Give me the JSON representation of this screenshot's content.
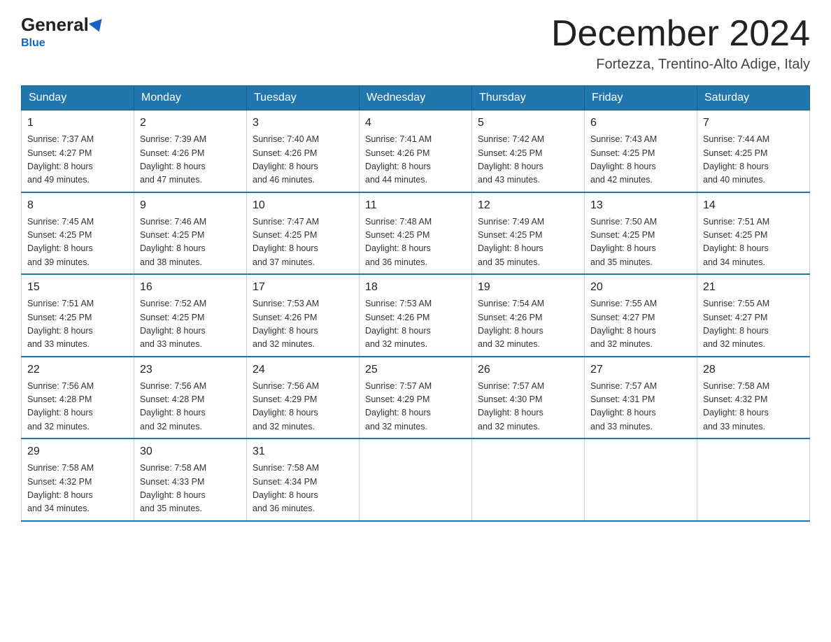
{
  "header": {
    "logo": {
      "general": "General",
      "blue": "Blue"
    },
    "title": "December 2024",
    "subtitle": "Fortezza, Trentino-Alto Adige, Italy"
  },
  "weekdays": [
    "Sunday",
    "Monday",
    "Tuesday",
    "Wednesday",
    "Thursday",
    "Friday",
    "Saturday"
  ],
  "weeks": [
    [
      {
        "day": "1",
        "sunrise": "7:37 AM",
        "sunset": "4:27 PM",
        "daylight": "8 hours and 49 minutes."
      },
      {
        "day": "2",
        "sunrise": "7:39 AM",
        "sunset": "4:26 PM",
        "daylight": "8 hours and 47 minutes."
      },
      {
        "day": "3",
        "sunrise": "7:40 AM",
        "sunset": "4:26 PM",
        "daylight": "8 hours and 46 minutes."
      },
      {
        "day": "4",
        "sunrise": "7:41 AM",
        "sunset": "4:26 PM",
        "daylight": "8 hours and 44 minutes."
      },
      {
        "day": "5",
        "sunrise": "7:42 AM",
        "sunset": "4:25 PM",
        "daylight": "8 hours and 43 minutes."
      },
      {
        "day": "6",
        "sunrise": "7:43 AM",
        "sunset": "4:25 PM",
        "daylight": "8 hours and 42 minutes."
      },
      {
        "day": "7",
        "sunrise": "7:44 AM",
        "sunset": "4:25 PM",
        "daylight": "8 hours and 40 minutes."
      }
    ],
    [
      {
        "day": "8",
        "sunrise": "7:45 AM",
        "sunset": "4:25 PM",
        "daylight": "8 hours and 39 minutes."
      },
      {
        "day": "9",
        "sunrise": "7:46 AM",
        "sunset": "4:25 PM",
        "daylight": "8 hours and 38 minutes."
      },
      {
        "day": "10",
        "sunrise": "7:47 AM",
        "sunset": "4:25 PM",
        "daylight": "8 hours and 37 minutes."
      },
      {
        "day": "11",
        "sunrise": "7:48 AM",
        "sunset": "4:25 PM",
        "daylight": "8 hours and 36 minutes."
      },
      {
        "day": "12",
        "sunrise": "7:49 AM",
        "sunset": "4:25 PM",
        "daylight": "8 hours and 35 minutes."
      },
      {
        "day": "13",
        "sunrise": "7:50 AM",
        "sunset": "4:25 PM",
        "daylight": "8 hours and 35 minutes."
      },
      {
        "day": "14",
        "sunrise": "7:51 AM",
        "sunset": "4:25 PM",
        "daylight": "8 hours and 34 minutes."
      }
    ],
    [
      {
        "day": "15",
        "sunrise": "7:51 AM",
        "sunset": "4:25 PM",
        "daylight": "8 hours and 33 minutes."
      },
      {
        "day": "16",
        "sunrise": "7:52 AM",
        "sunset": "4:25 PM",
        "daylight": "8 hours and 33 minutes."
      },
      {
        "day": "17",
        "sunrise": "7:53 AM",
        "sunset": "4:26 PM",
        "daylight": "8 hours and 32 minutes."
      },
      {
        "day": "18",
        "sunrise": "7:53 AM",
        "sunset": "4:26 PM",
        "daylight": "8 hours and 32 minutes."
      },
      {
        "day": "19",
        "sunrise": "7:54 AM",
        "sunset": "4:26 PM",
        "daylight": "8 hours and 32 minutes."
      },
      {
        "day": "20",
        "sunrise": "7:55 AM",
        "sunset": "4:27 PM",
        "daylight": "8 hours and 32 minutes."
      },
      {
        "day": "21",
        "sunrise": "7:55 AM",
        "sunset": "4:27 PM",
        "daylight": "8 hours and 32 minutes."
      }
    ],
    [
      {
        "day": "22",
        "sunrise": "7:56 AM",
        "sunset": "4:28 PM",
        "daylight": "8 hours and 32 minutes."
      },
      {
        "day": "23",
        "sunrise": "7:56 AM",
        "sunset": "4:28 PM",
        "daylight": "8 hours and 32 minutes."
      },
      {
        "day": "24",
        "sunrise": "7:56 AM",
        "sunset": "4:29 PM",
        "daylight": "8 hours and 32 minutes."
      },
      {
        "day": "25",
        "sunrise": "7:57 AM",
        "sunset": "4:29 PM",
        "daylight": "8 hours and 32 minutes."
      },
      {
        "day": "26",
        "sunrise": "7:57 AM",
        "sunset": "4:30 PM",
        "daylight": "8 hours and 32 minutes."
      },
      {
        "day": "27",
        "sunrise": "7:57 AM",
        "sunset": "4:31 PM",
        "daylight": "8 hours and 33 minutes."
      },
      {
        "day": "28",
        "sunrise": "7:58 AM",
        "sunset": "4:32 PM",
        "daylight": "8 hours and 33 minutes."
      }
    ],
    [
      {
        "day": "29",
        "sunrise": "7:58 AM",
        "sunset": "4:32 PM",
        "daylight": "8 hours and 34 minutes."
      },
      {
        "day": "30",
        "sunrise": "7:58 AM",
        "sunset": "4:33 PM",
        "daylight": "8 hours and 35 minutes."
      },
      {
        "day": "31",
        "sunrise": "7:58 AM",
        "sunset": "4:34 PM",
        "daylight": "8 hours and 36 minutes."
      },
      null,
      null,
      null,
      null
    ]
  ],
  "labels": {
    "sunrise": "Sunrise:",
    "sunset": "Sunset:",
    "daylight": "Daylight:"
  }
}
